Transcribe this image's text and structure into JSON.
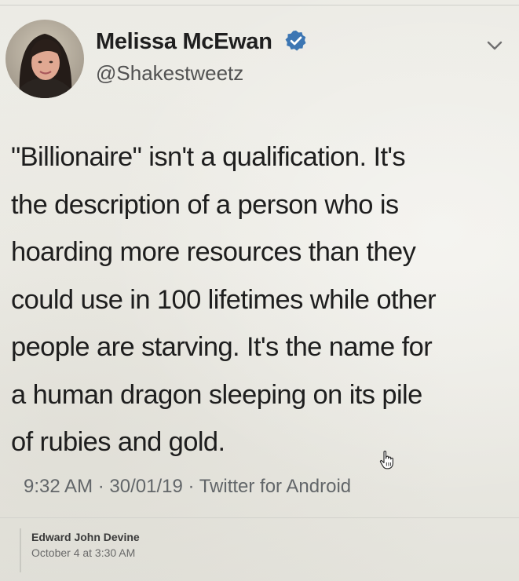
{
  "tweet": {
    "author_name": "Melissa McEwan",
    "handle": "@Shakestweetz",
    "verified": true,
    "text": "\"Billionaire\" isn't a qualification. It's\nthe description of a person who is\nhoarding more resources than they\ncould use in 100 lifetimes while other\npeople are starving. It's the name for\na human dragon sleeping on its pile\nof rubies and gold.",
    "meta": "9:32 AM · 30/01/19 · Twitter for Android"
  },
  "comment": {
    "author": "Edward John Devine",
    "timestamp": "October 4 at 3:30 AM"
  },
  "colors": {
    "verified_blue": "#3d76b3",
    "text_dark": "#1e1e1e",
    "meta_gray": "#626669"
  },
  "icons": {
    "verified": "verified-badge-icon",
    "menu": "chevron-down-icon",
    "cursor": "hand-pointer-icon"
  }
}
